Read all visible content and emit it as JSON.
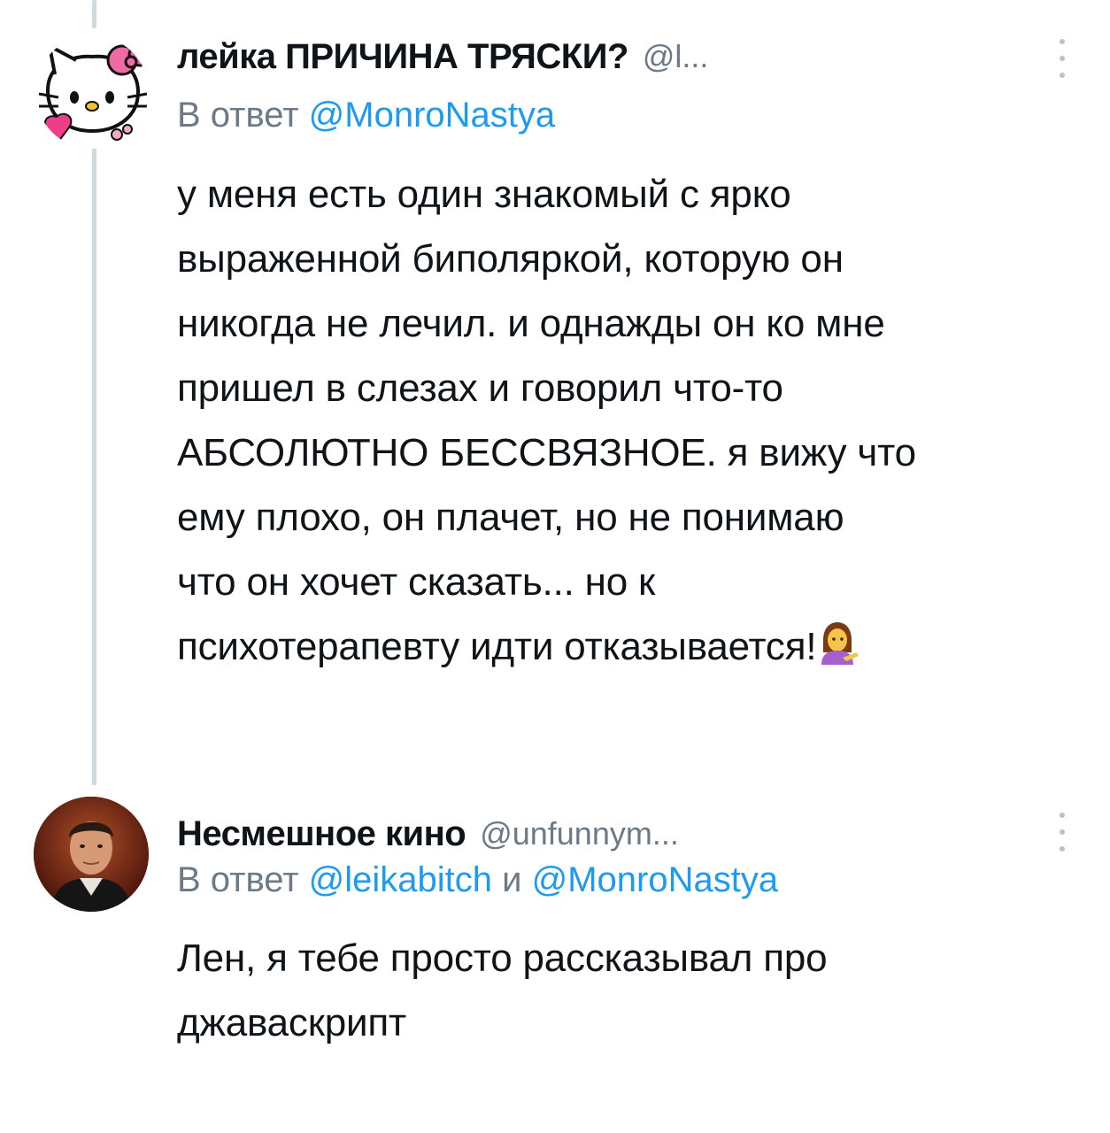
{
  "tweets": [
    {
      "author_name": "лейка ПРИЧИНА ТРЯСКИ?",
      "author_handle": "@l...",
      "reply_prefix": "В ответ",
      "reply_mentions": [
        "@MonroNastya"
      ],
      "reply_joiner": "",
      "avatar_icon": "hello-kitty-avatar",
      "body_lines": [
        "у меня есть один знакомый с ярко",
        "выраженной биполяркой, которую он",
        "никогда не лечил. и однажды он ко мне",
        "пришел в слезах и говорил что-то",
        "АБСОЛЮТНО БЕССВЯЗНОЕ. я вижу что",
        "ему плохо, он плачет, но не понимаю",
        "что он хочет сказать... но к",
        "психотерапевту идти отказывается!"
      ],
      "trailing_emoji": "person-tipping-hand-emoji"
    },
    {
      "author_name": "Несмешное кино",
      "author_handle": "@unfunnym...",
      "reply_prefix": "В ответ",
      "reply_mentions": [
        "@leikabitch",
        "@MonroNastya"
      ],
      "reply_joiner": "и",
      "avatar_icon": "man-portrait-avatar",
      "body_lines": [
        "Лен, я тебе просто рассказывал про",
        "джаваскрипт"
      ]
    }
  ],
  "colors": {
    "text": "#0f1419",
    "secondary": "#6b7a86",
    "mention": "#1d9bf0",
    "thread_line": "#cfd9de"
  }
}
